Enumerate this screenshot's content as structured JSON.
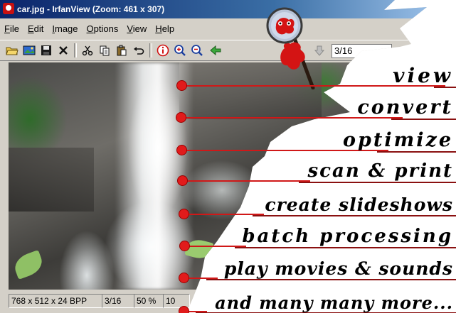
{
  "window": {
    "title": "car.jpg - IrfanView (Zoom: 461 x 307)"
  },
  "menubar": {
    "items": [
      {
        "key": "F",
        "rest": "ile"
      },
      {
        "key": "E",
        "rest": "dit"
      },
      {
        "key": "I",
        "rest": "mage"
      },
      {
        "key": "O",
        "rest": "ptions"
      },
      {
        "key": "V",
        "rest": "iew"
      },
      {
        "key": "H",
        "rest": "elp"
      }
    ]
  },
  "toolbar": {
    "page_indicator": "3/16",
    "icons": [
      "open-icon",
      "slideshow-icon",
      "save-icon",
      "delete-icon",
      "cut-icon",
      "copy-icon",
      "paste-icon",
      "undo-icon",
      "info-icon",
      "zoom-in-icon",
      "zoom-out-icon",
      "previous-icon"
    ]
  },
  "statusbar": {
    "dimensions": "768 x 512 x 24 BPP",
    "page": "3/16",
    "zoom": "50 %",
    "extra": "10"
  },
  "features": [
    {
      "label": "view"
    },
    {
      "label": "convert"
    },
    {
      "label": "optimize"
    },
    {
      "label": "scan & print"
    },
    {
      "label": "create slideshows"
    },
    {
      "label": "batch processing"
    },
    {
      "label": "play movies & sounds"
    },
    {
      "label": "and many many more..."
    }
  ],
  "colors": {
    "accent_red": "#e11b1b",
    "window_face": "#d4d0c8",
    "titlebar": "#0a246a"
  }
}
